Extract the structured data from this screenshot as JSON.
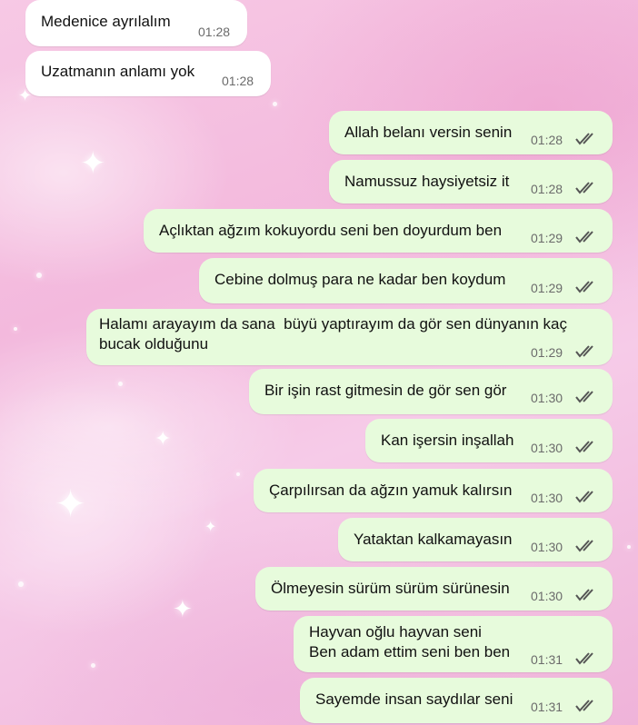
{
  "chat": {
    "incoming": [
      {
        "text": "Medenice ayrılalım",
        "time": "01:28"
      },
      {
        "text": "Uzatmanın anlamı yok",
        "time": "01:28"
      }
    ],
    "outgoing": [
      {
        "text": "Allah belanı versin senin",
        "time": "01:28",
        "status": "read-double-check-icon"
      },
      {
        "text": "Namussuz haysiyetsiz it",
        "time": "01:28",
        "status": "read-double-check-icon"
      },
      {
        "text": "Açlıktan ağzım kokuyordu seni ben doyurdum ben",
        "time": "01:29",
        "status": "read-double-check-icon"
      },
      {
        "text": "Cebine dolmuş para ne kadar ben koydum",
        "time": "01:29",
        "status": "read-double-check-icon"
      },
      {
        "text": "Halamı arayayım da sana  büyü yaptırayım da gör sen dünyanın kaç\nbucak olduğunu",
        "time": "01:29",
        "status": "read-double-check-icon"
      },
      {
        "text": "Bir işin rast gitmesin de gör sen gör",
        "time": "01:30",
        "status": "read-double-check-icon"
      },
      {
        "text": "Kan işersin inşallah",
        "time": "01:30",
        "status": "read-double-check-icon"
      },
      {
        "text": "Çarpılırsan da ağzın yamuk kalırsın",
        "time": "01:30",
        "status": "read-double-check-icon"
      },
      {
        "text": "Yataktan kalkamayasın",
        "time": "01:30",
        "status": "read-double-check-icon"
      },
      {
        "text": "Ölmeyesin sürüm sürüm sürünesin",
        "time": "01:30",
        "status": "read-double-check-icon"
      },
      {
        "text": "Hayvan oğlu hayvan seni\nBen adam ettim seni ben ben",
        "time": "01:31",
        "status": "read-double-check-icon"
      },
      {
        "text": "Sayemde insan saydılar seni",
        "time": "01:31",
        "status": "read-double-check-icon"
      }
    ]
  },
  "colors": {
    "incoming_bubble": "#ffffff",
    "outgoing_bubble": "#e7fbdc",
    "timestamp": "#6b6b6b",
    "wallpaper": "#f3b9dd"
  }
}
